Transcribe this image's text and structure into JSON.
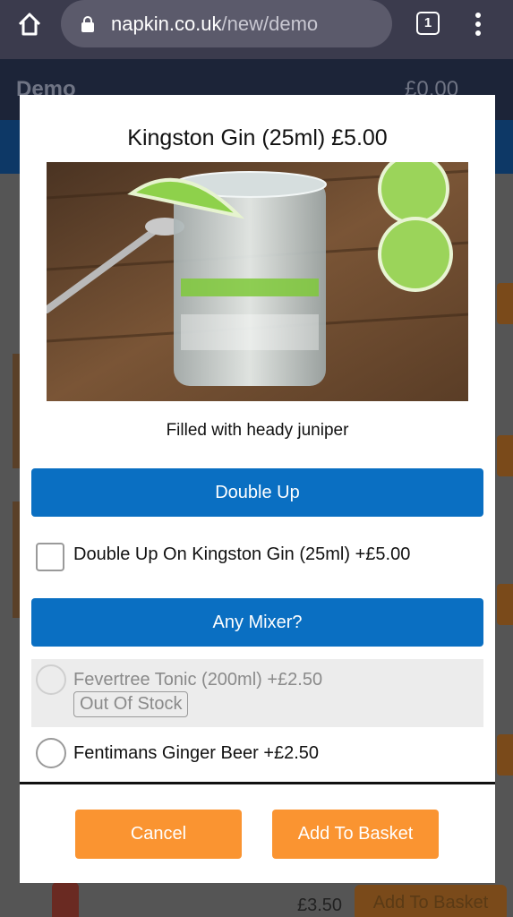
{
  "browser": {
    "url_host": "napkin.co.uk",
    "url_path": "/new/demo",
    "tab_count": "1"
  },
  "background": {
    "menu_label": "Demo",
    "cart_total": "£0.00",
    "bottom_price": "£3.50",
    "bottom_button": "Add To Basket"
  },
  "modal": {
    "title": "Kingston Gin (25ml) £5.00",
    "description": "Filled with heady juniper",
    "double_up_header": "Double Up",
    "double_up_option": "Double Up On Kingston Gin (25ml) +£5.00",
    "mixer_header": "Any Mixer?",
    "mixer_options": [
      {
        "label": "Fevertree Tonic (200ml) +£2.50",
        "badge": "Out Of Stock"
      },
      {
        "label": "Fentimans Ginger Beer +£2.50"
      }
    ],
    "cancel_label": "Cancel",
    "add_label": "Add To Basket"
  },
  "colors": {
    "accent_blue": "#0a6fc2",
    "accent_orange": "#fa9431",
    "browser_bar": "#3b3b4d"
  }
}
